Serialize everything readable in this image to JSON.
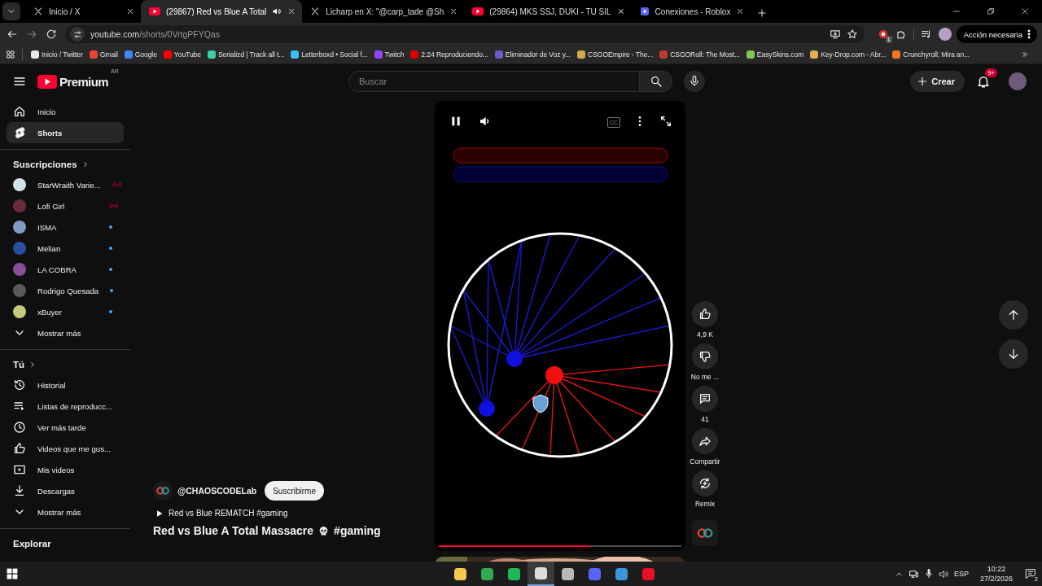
{
  "browser": {
    "tabs": [
      {
        "kind": "x",
        "title": "Inicio / X",
        "selected": false,
        "audio": false
      },
      {
        "kind": "youtube",
        "title": "(29867) Red vs Blue A Total",
        "selected": true,
        "audio": true
      },
      {
        "kind": "x",
        "title": "Licharp en X: \"@carp_tade @Sh",
        "selected": false,
        "audio": false
      },
      {
        "kind": "youtube",
        "title": "(29864) MKS SSJ, DUKI - TU SIL",
        "selected": false,
        "audio": false
      },
      {
        "kind": "roblox",
        "title": "Conexiones - Roblox",
        "selected": false,
        "audio": false
      }
    ],
    "url_host": "youtube.com",
    "url_path": "/shorts/0VrtgPFYQas",
    "extension_badge": "1",
    "action_button": "Acción necesaria",
    "bookmarks": [
      {
        "label": "Inicio / Twitter",
        "color": "#e8e8e8"
      },
      {
        "label": "Gmail",
        "color": "#ea4335"
      },
      {
        "label": "Google",
        "color": "#4285f4"
      },
      {
        "label": "YouTube",
        "color": "#ff0000"
      },
      {
        "label": "Serializd | Track all t...",
        "color": "#3ccfa8"
      },
      {
        "label": "Letterboxd • Social f...",
        "color": "#40bcf4"
      },
      {
        "label": "Twitch",
        "color": "#9146ff"
      },
      {
        "label": "2:24 Reproduciendo...",
        "color": "#e00000"
      },
      {
        "label": "Eliminador de Voz y...",
        "color": "#6a5acd"
      },
      {
        "label": "CSGOEmpire - The...",
        "color": "#d4a94a"
      },
      {
        "label": "CSGORoll: The Most...",
        "color": "#c0392b"
      },
      {
        "label": "EasySkins.com",
        "color": "#7ec850"
      },
      {
        "label": "Key-Drop.com - Abr...",
        "color": "#e0b050"
      },
      {
        "label": "Crunchyroll: Mira an...",
        "color": "#f47521"
      }
    ]
  },
  "youtube": {
    "logo": "Premium",
    "region": "AR",
    "search_placeholder": "Buscar",
    "create_label": "Crear",
    "notification_count": "9+",
    "sidebar": {
      "main": [
        {
          "kind": "home",
          "label": "Inicio",
          "selected": false
        },
        {
          "kind": "shorts",
          "label": "Shorts",
          "selected": true
        }
      ],
      "subscriptions_title": "Suscripciones",
      "subscriptions": [
        {
          "name": "StarWraith Varie...",
          "color": "#cfe3e8",
          "kind": "live"
        },
        {
          "name": "Lofi Girl",
          "color": "#6b2a3a",
          "kind": "live"
        },
        {
          "name": "ISMA",
          "color": "#7d9bc4",
          "kind": "new"
        },
        {
          "name": "Melian",
          "color": "#2a4fa0",
          "kind": "new"
        },
        {
          "name": "LA COBRA",
          "color": "#8a4d9a",
          "kind": "new"
        },
        {
          "name": "Rodrigo Quesada",
          "color": "#5a5a5a",
          "kind": "new"
        },
        {
          "name": "xBuyer",
          "color": "#c8c87a",
          "kind": "new"
        }
      ],
      "subscriptions_more": "Mostrar más",
      "you_title": "Tú",
      "you_items": [
        {
          "kind": "history",
          "label": "Historial"
        },
        {
          "kind": "playlists",
          "label": "Listas de reproducc..."
        },
        {
          "kind": "clock",
          "label": "Ver más tarde"
        },
        {
          "kind": "like",
          "label": "Videos que me gus..."
        },
        {
          "kind": "video",
          "label": "Mis videos"
        },
        {
          "kind": "download",
          "label": "Descargas"
        }
      ],
      "you_more": "Mostrar más",
      "explore_title": "Explorar"
    },
    "short": {
      "captions_label": "CC",
      "progress": {
        "level": 0.62
      },
      "channel": "@CHAOSCODELab",
      "subscribe": "Suscribirme",
      "related": "Red vs Blue REMATCH #gaming",
      "title": "Red vs Blue A Total Massacre",
      "title_tag": "#gaming",
      "actions": [
        {
          "kind": "like",
          "label": "4,9 K"
        },
        {
          "kind": "dislike",
          "label": "No me ..."
        },
        {
          "kind": "comment",
          "label": "41"
        },
        {
          "kind": "share",
          "label": "Compartir"
        },
        {
          "kind": "remix",
          "label": "Remix"
        }
      ]
    }
  },
  "taskbar": {
    "apps": [
      {
        "color": "#f2c94c",
        "selected": false
      },
      {
        "color": "#34a853",
        "selected": false
      },
      {
        "color": "#1db954",
        "selected": false
      },
      {
        "color": "#dddddd",
        "selected": true
      },
      {
        "color": "#b8b8b8",
        "selected": false
      },
      {
        "color": "#5865f2",
        "selected": false
      },
      {
        "color": "#3a96dd",
        "selected": false
      },
      {
        "color": "#e81123",
        "selected": false
      }
    ],
    "language": "ESP",
    "time": "10:22",
    "date": "27/2/2026",
    "notifications": "2"
  }
}
